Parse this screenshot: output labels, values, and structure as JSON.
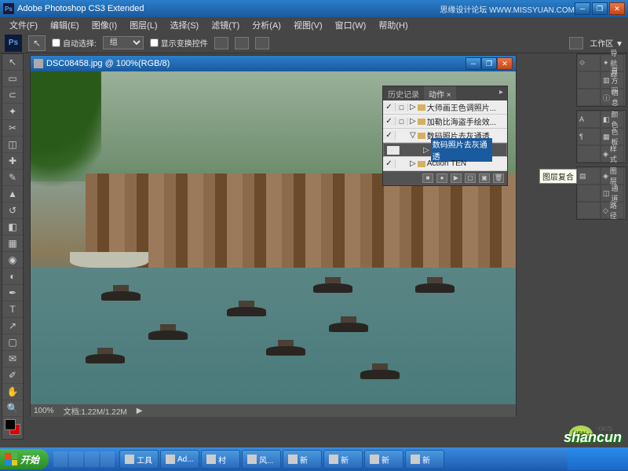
{
  "titlebar": {
    "app_title": "Adobe Photoshop CS3 Extended",
    "watermark": "思缘设计论坛  WWW.MISSYUAN.COM"
  },
  "menu": {
    "file": "文件(F)",
    "edit": "编辑(E)",
    "image": "图像(I)",
    "layer": "图层(L)",
    "select": "选择(S)",
    "filter": "滤镜(T)",
    "analysis": "分析(A)",
    "view": "视图(V)",
    "window": "窗口(W)",
    "help": "帮助(H)"
  },
  "options": {
    "auto_select": "自动选择:",
    "group": "组",
    "show_transform": "显示变换控件",
    "workspace": "工作区 ▼"
  },
  "document": {
    "title": "DSC08458.jpg @ 100%(RGB/8)",
    "zoom": "100%",
    "filesize": "文档:1.22M/1.22M"
  },
  "actions_panel": {
    "history_tab": "历史记录",
    "actions_tab": "动作 ×",
    "items": [
      {
        "label": "大师画王色调照片...",
        "folder": true
      },
      {
        "label": "加勒比海盗手绘效...",
        "folder": true
      },
      {
        "label": "数码照片去灰通透",
        "folder": true,
        "expanded": true
      },
      {
        "label": "数码照片去灰通透",
        "selected": true
      },
      {
        "label": "Action TEN",
        "folder": true
      }
    ]
  },
  "right_panels": {
    "navigator": "导航器",
    "histogram": "直方图",
    "info": "信息",
    "color": "颜色",
    "swatches": "色板",
    "styles": "样式",
    "layers": "图层",
    "channels": "通道",
    "paths": "路径",
    "tooltip": "图层复合"
  },
  "badges": {
    "percent": "55%",
    "ok1": "0K/S",
    "ok2": "0K/S"
  },
  "watermark_logo": "shancun",
  "taskbar": {
    "start": "开始",
    "tasks": [
      {
        "label": "工具"
      },
      {
        "label": "Ad..."
      },
      {
        "label": "村"
      },
      {
        "label": "风..."
      },
      {
        "label": "新"
      },
      {
        "label": "新"
      },
      {
        "label": "新"
      },
      {
        "label": "新"
      }
    ]
  }
}
